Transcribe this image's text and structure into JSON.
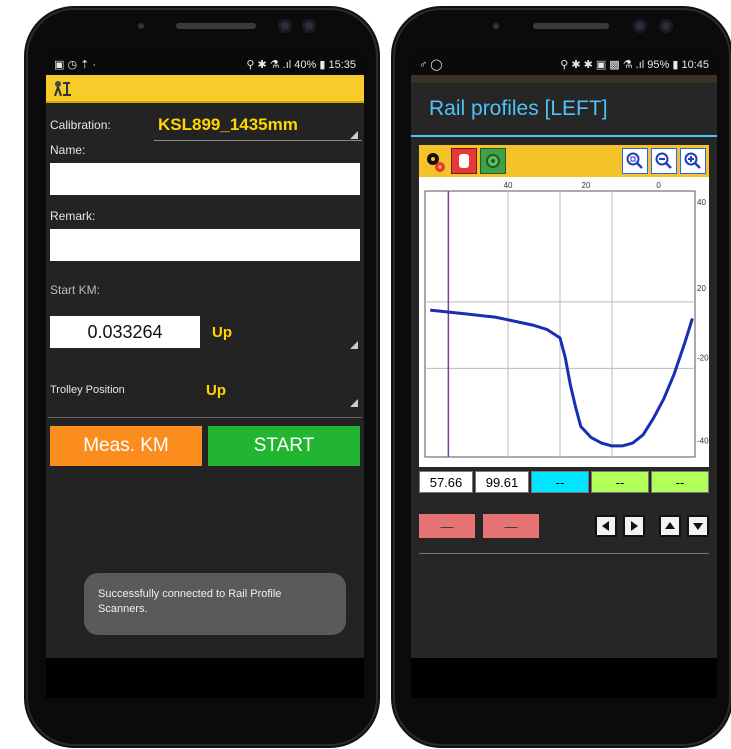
{
  "left_phone": {
    "status": {
      "left": "▣ ◷ ⇡ ·",
      "right": "⚲ ✱ ⚗ .ıl 40% ▮ 15:35"
    },
    "header_icon": "tripod-level-icon",
    "calibration": {
      "label": "Calibration:",
      "value": "KSL899_1435mm"
    },
    "name": {
      "label": "Name:",
      "value": ""
    },
    "remark": {
      "label": "Remark:",
      "value": ""
    },
    "start_km": {
      "label": "Start KM:",
      "value": "0.033264",
      "direction": "Up"
    },
    "trolley": {
      "label": "Trolley Position",
      "value": "Up"
    },
    "buttons": {
      "meas_km": "Meas. KM",
      "start": "START"
    },
    "toast": "Successfully connected to Rail Profile Scanners."
  },
  "right_phone": {
    "status": {
      "left": "♂ ◯",
      "right": "⚲ ✱ ✱ ▣ ▩ ⚗ .ıl 95% ▮ 10:45"
    },
    "title": "Rail profiles [LEFT]",
    "toolbar_icons": [
      "settings-gear-icon",
      "stop-hand-icon",
      "green-record-icon",
      "zoom-fit-icon",
      "zoom-out-icon",
      "zoom-in-icon"
    ],
    "readouts": [
      "57.66",
      "99.61",
      "--",
      "--",
      "--"
    ],
    "bottom_buttons": [
      "—",
      "—"
    ],
    "nav_icons": [
      "arrow-left-icon",
      "arrow-right-icon",
      "arrow-up-icon",
      "arrow-down-icon"
    ],
    "colors": {
      "title": "#4fc3f7",
      "toolbar": "#f4c329",
      "cyan": "#00e5ff",
      "lime": "#b2ff59",
      "profile": "#1a2db5",
      "pink": "#e57373"
    }
  },
  "chart_data": {
    "type": "line",
    "title": "",
    "xlabel": "",
    "ylabel": "",
    "x_ticks": [
      "40",
      "20",
      "0"
    ],
    "y_ticks": [
      "40",
      "20",
      "-20",
      "-40"
    ],
    "series": [
      {
        "values": [
          [
            -50,
            -3
          ],
          [
            -45,
            -3.5
          ],
          [
            -40,
            -4
          ],
          [
            -35,
            -4.5
          ],
          [
            -30,
            -5
          ],
          [
            -25,
            -5.5
          ],
          [
            -20,
            -6.5
          ],
          [
            -15,
            -7.5
          ],
          [
            -10,
            -8.5
          ],
          [
            -5,
            -10
          ],
          [
            0,
            -13
          ],
          [
            2,
            -20
          ],
          [
            4,
            -30
          ],
          [
            6,
            -38
          ],
          [
            8,
            -45
          ],
          [
            12,
            -49
          ],
          [
            16,
            -51
          ],
          [
            20,
            -52
          ],
          [
            24,
            -52
          ],
          [
            28,
            -51
          ],
          [
            32,
            -48
          ],
          [
            36,
            -42
          ],
          [
            40,
            -35
          ],
          [
            44,
            -26
          ],
          [
            48,
            -15
          ],
          [
            51,
            -6
          ]
        ]
      }
    ],
    "xlim": [
      -52,
      52
    ],
    "ylim": [
      -56,
      40
    ],
    "marker_line_x": -43,
    "grid_x": [
      -20,
      0,
      20
    ],
    "grid_y": [
      0,
      -24
    ]
  }
}
